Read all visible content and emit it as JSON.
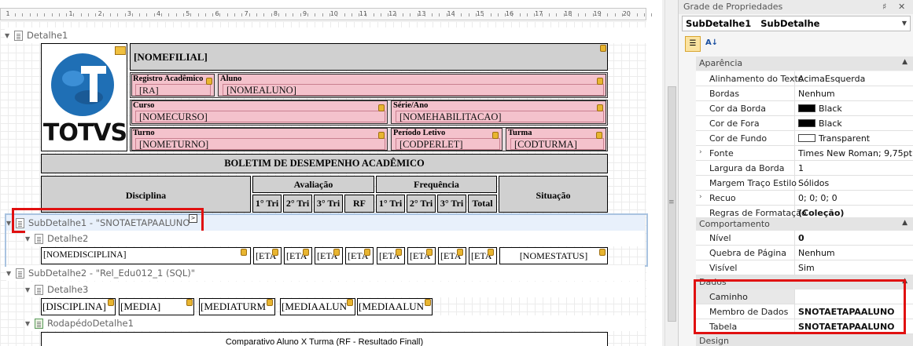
{
  "ruler": {
    "ticks": [
      "1",
      "1",
      "2",
      "3",
      "4",
      "5",
      "6",
      "7",
      "8",
      "9",
      "10",
      "11",
      "12",
      "13",
      "14",
      "15",
      "16",
      "17",
      "18",
      "19",
      "20"
    ]
  },
  "bands": {
    "detalhe1": "Detalhe1",
    "subdetalhe1": "SubDetalhe1 - \"SNOTAETAPAALUNO\"",
    "detalhe2": "Detalhe2",
    "subdetalhe2": "SubDetalhe2 - \"Rel_Edu012_1 (SQL)\"",
    "detalhe3": "Detalhe3",
    "rodape": "RodapédoDetalhe1"
  },
  "header": {
    "logo_text": "TOTVS",
    "nomefilial": "[NOMEFILIAL]",
    "registro_label": "Registro Acadêmico",
    "registro_value": "[RA]",
    "aluno_label": "Aluno",
    "aluno_value": "[NOMEALUNO]",
    "curso_label": "Curso",
    "curso_value": "[NOMECURSO]",
    "serie_label": "Série/Ano",
    "serie_value": "[NOMEHABILITACAO]",
    "turno_label": "Turno",
    "turno_value": "[NOMETURNO]",
    "periodo_label": "Período Letivo",
    "periodo_value": "[CODPERLET]",
    "turma_label": "Turma",
    "turma_value": "[CODTURMA]",
    "boletim": "BOLETIM DE DESEMPENHO ACADÊMICO",
    "disciplina": "Disciplina",
    "avaliacao": "Avaliação",
    "frequencia": "Frequência",
    "situacao": "Situação",
    "aval_cols": [
      "1° Tri",
      "2° Tri",
      "3° Tri",
      "RF"
    ],
    "freq_cols": [
      "1° Tri",
      "2° Tri",
      "3° Tri",
      "Total"
    ]
  },
  "detail2": {
    "nomedisciplina": "[NOMEDISCIPLINA]",
    "eta_cells": [
      "[ETA",
      "[ETA",
      "[ETA",
      "[ETA",
      "[ETA",
      "[ETA",
      "[ETA",
      "[ETA"
    ],
    "nomestatus": "[NOMESTATUS]"
  },
  "detail3": {
    "fields": [
      "[DISCIPLINA]",
      "[MEDIA]",
      "[MEDIATURM",
      "[MEDIAALUN",
      "[MEDIAALUN"
    ]
  },
  "footer": {
    "title": "Comparativo Aluno X Turma (RF - Resultado Finall)"
  },
  "props": {
    "title": "Grade de Propriedades",
    "pin": "♯",
    "close": "✕",
    "object": "SubDetalhe1   SubDetalhe",
    "categories": {
      "aparencia": "Aparência",
      "comportamento": "Comportamento",
      "dados": "Dados",
      "design": "Design"
    },
    "aparencia_rows": [
      {
        "name": "Alinhamento do Texto",
        "value": "AcimaEsquerda"
      },
      {
        "name": "Bordas",
        "value": "Nenhum"
      },
      {
        "name": "Cor da Borda",
        "value": "Black"
      },
      {
        "name": "Cor de Fora",
        "value": "Black"
      },
      {
        "name": "Cor de Fundo",
        "value": "Transparent"
      },
      {
        "name": "Fonte",
        "value": "Times New Roman; 9,75pt"
      },
      {
        "name": "Largura da Borda",
        "value": "1"
      },
      {
        "name": "Margem Traço Estilo",
        "value": "Sólidos"
      },
      {
        "name": "Recuo",
        "value": "0; 0; 0; 0"
      },
      {
        "name": "Regras de Formatação",
        "value": "(Coleção)"
      }
    ],
    "comportamento_rows": [
      {
        "name": "Nível",
        "value": "0"
      },
      {
        "name": "Quebra de Página",
        "value": "Nenhum"
      },
      {
        "name": "Visível",
        "value": "Sim"
      }
    ],
    "dados_rows": [
      {
        "name": "Caminho",
        "value": ""
      },
      {
        "name": "Membro de Dados",
        "value": "SNOTAETAPAALUNO"
      },
      {
        "name": "Tabela",
        "value": "SNOTAETAPAALUNO"
      }
    ],
    "colors": {
      "border": "#000000",
      "fore": "#000000",
      "back": "#ffffff"
    }
  }
}
